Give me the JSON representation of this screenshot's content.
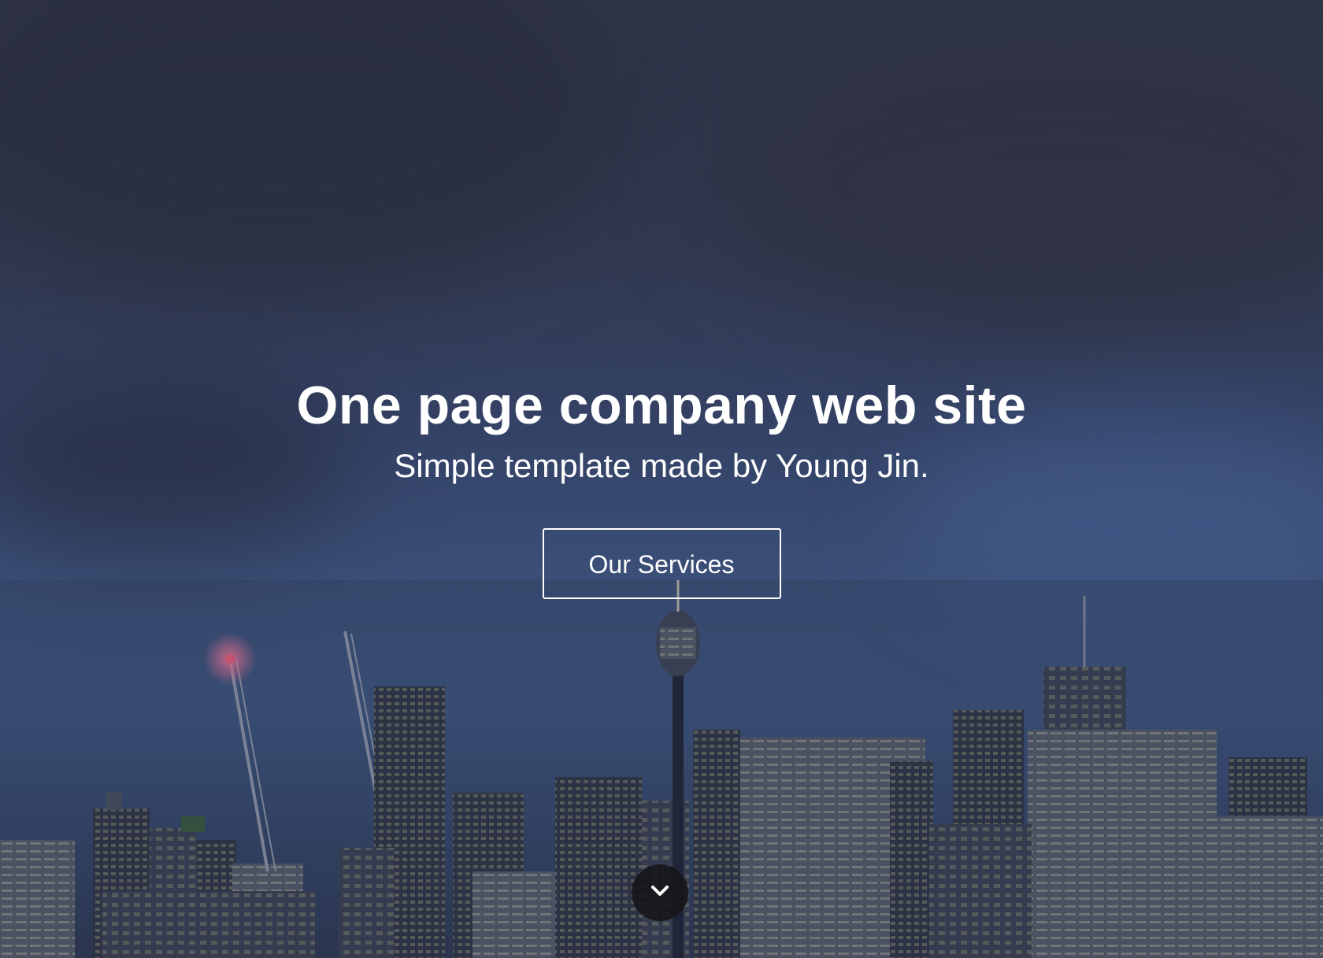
{
  "hero": {
    "title": "One page company web site",
    "subtitle": "Simple template made by Young Jin.",
    "cta_label": "Our Services",
    "scroll_icon": "chevron-down-icon",
    "background_image": "city-skyline-night"
  },
  "colors": {
    "text": "#ffffff",
    "overlay": "#323a52",
    "scroll_button_bg": "#141418"
  }
}
